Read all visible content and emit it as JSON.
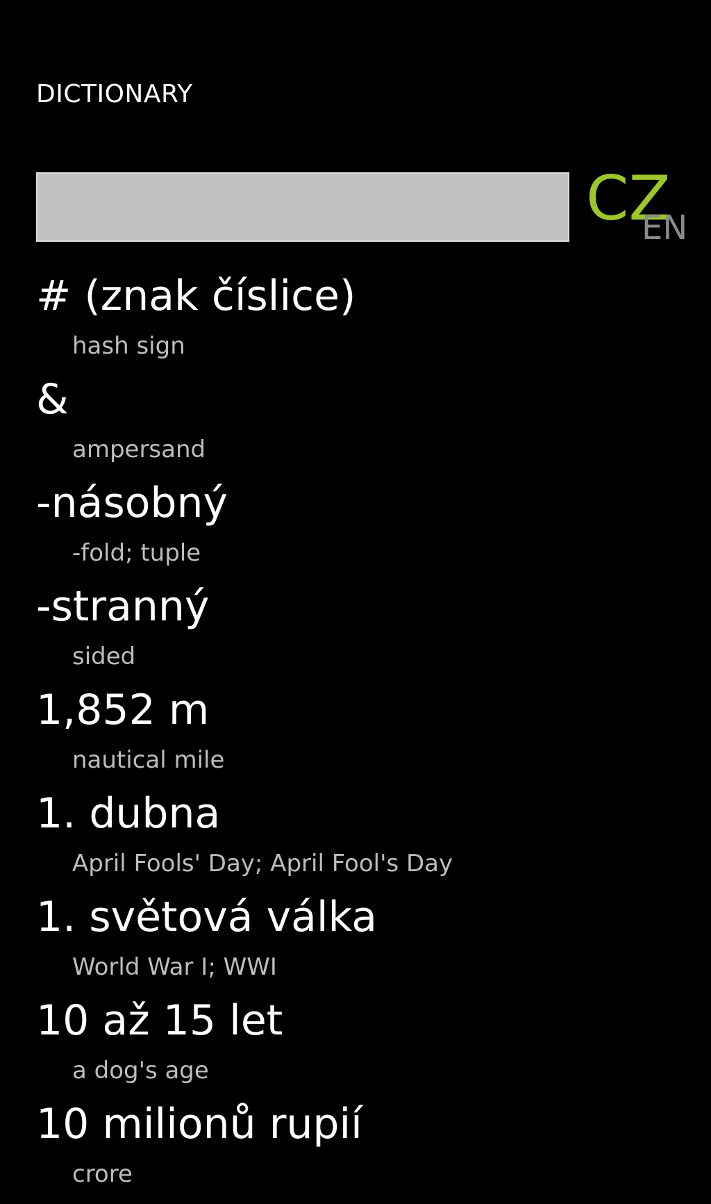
{
  "app": {
    "title": "DICTIONARY"
  },
  "search": {
    "value": "",
    "placeholder": ""
  },
  "language_toggle": {
    "primary": "CZ",
    "secondary": "EN"
  },
  "colors": {
    "background": "#000000",
    "accent": "#9dc72b",
    "muted": "#8a8a8a",
    "translation": "#bdbdbd"
  },
  "entries": [
    {
      "term": "# (znak číslice)",
      "translation": "hash sign"
    },
    {
      "term": "&",
      "translation": "ampersand"
    },
    {
      "term": "-násobný",
      "translation": "-fold; tuple"
    },
    {
      "term": "-stranný",
      "translation": "sided"
    },
    {
      "term": "1,852 m",
      "translation": "nautical mile"
    },
    {
      "term": "1. dubna",
      "translation": "April Fools' Day; April Fool's Day"
    },
    {
      "term": "1. světová válka",
      "translation": "World War I; WWI"
    },
    {
      "term": "10 až 15 let",
      "translation": "a dog's age"
    },
    {
      "term": "10 milionů rupií",
      "translation": "crore"
    }
  ]
}
